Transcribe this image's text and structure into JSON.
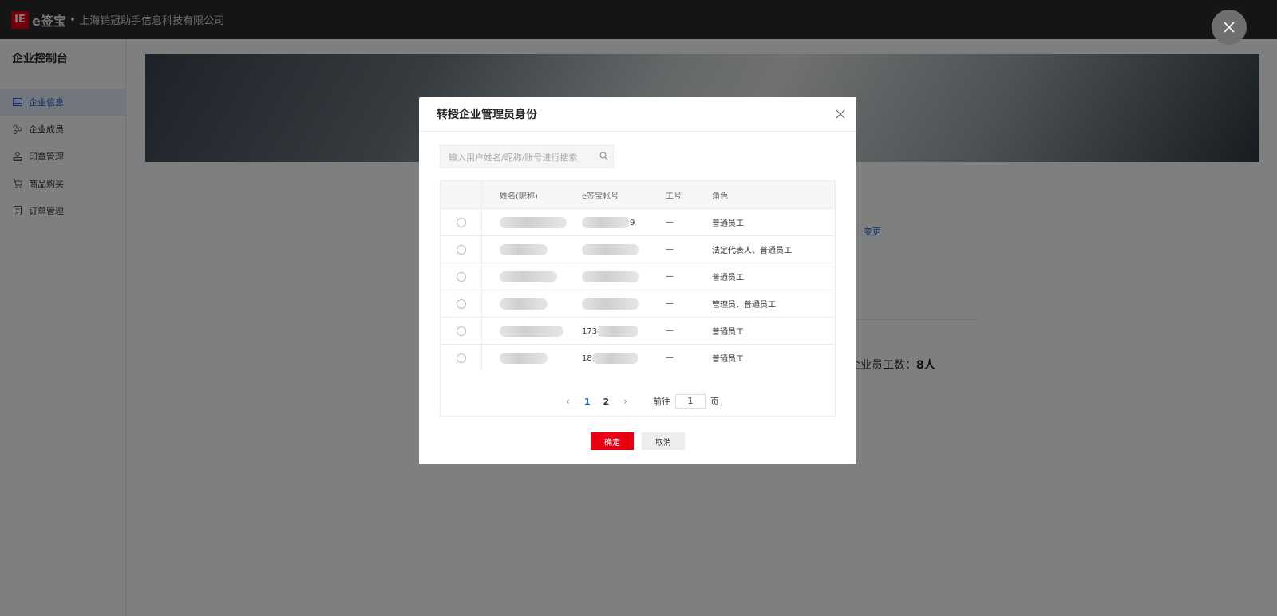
{
  "brand": {
    "logo_mark": "IE",
    "name": "e签宝",
    "dot": "•",
    "company": "上海销冠助手信息科技有限公司"
  },
  "sidebar": {
    "title": "企业控制台",
    "items": [
      {
        "label": "企业信息",
        "icon": "table-icon",
        "active": true
      },
      {
        "label": "企业成员",
        "icon": "org-tree-icon",
        "active": false
      },
      {
        "label": "印章管理",
        "icon": "stamp-icon",
        "active": false
      },
      {
        "label": "商品购买",
        "icon": "cart-icon",
        "active": false
      },
      {
        "label": "订单管理",
        "icon": "order-list-icon",
        "active": false
      }
    ]
  },
  "background": {
    "change_link": "变更",
    "employee_label": "企业员工数：",
    "employee_value": "8人"
  },
  "modal": {
    "title": "转授企业管理员身份",
    "search_placeholder": "输入用户姓名/昵称/账号进行搜索",
    "columns": [
      "姓名(昵称)",
      "e签宝帐号",
      "工号",
      "角色"
    ],
    "rows": [
      {
        "name_visible": "",
        "account_visible": "9",
        "employee_no": "—",
        "role": "普通员工"
      },
      {
        "name_visible": "",
        "account_visible": "",
        "employee_no": "—",
        "role": "法定代表人、普通员工"
      },
      {
        "name_visible": "",
        "account_visible": "",
        "employee_no": "—",
        "role": "普通员工"
      },
      {
        "name_visible": "",
        "account_visible": "",
        "employee_no": "—",
        "role": "管理员、普通员工"
      },
      {
        "name_visible": "",
        "account_visible": "173",
        "employee_no": "—",
        "role": "普通员工"
      },
      {
        "name_visible": "",
        "account_visible": "18",
        "employee_no": "—",
        "role": "普通员工"
      }
    ],
    "pagination": {
      "pages": [
        "1",
        "2"
      ],
      "current": "1",
      "goto_label": "前往",
      "goto_value": "1",
      "page_suffix": "页"
    },
    "ok_label": "确定",
    "cancel_label": "取消"
  },
  "colors": {
    "accent": "#e60012",
    "link": "#1e65d8",
    "topbar": "#2b2b2d"
  }
}
